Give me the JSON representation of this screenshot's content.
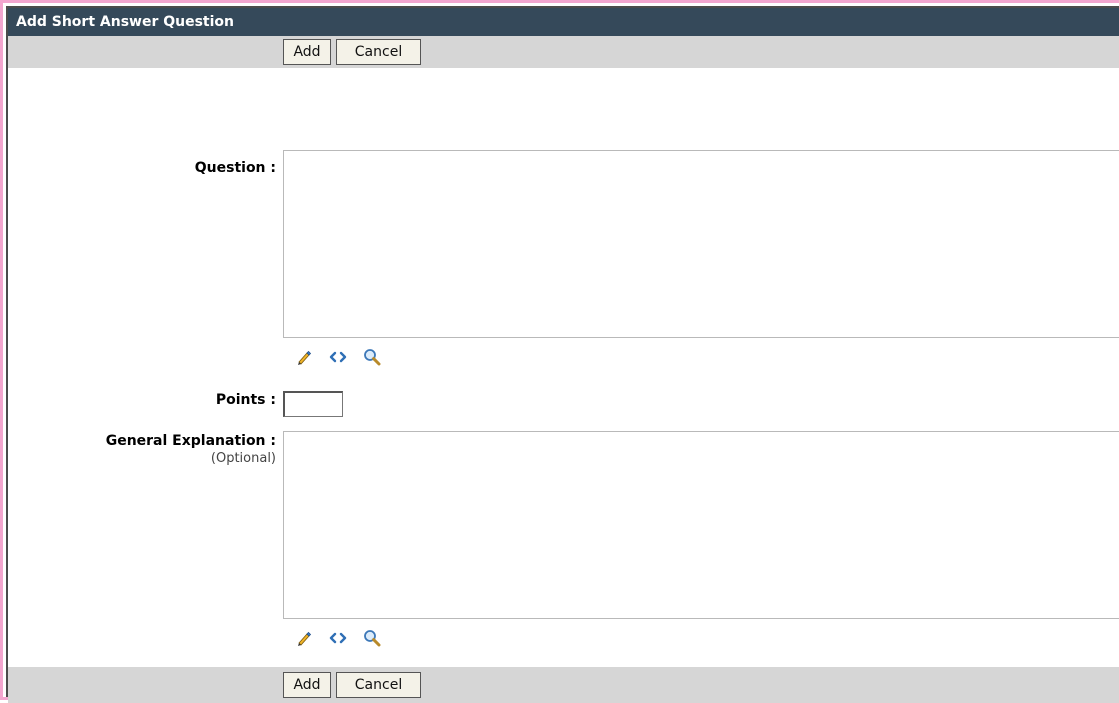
{
  "title": "Add Short Answer Question",
  "toolbar_top": {
    "add_label": "Add",
    "cancel_label": "Cancel"
  },
  "toolbar_bottom": {
    "add_label": "Add",
    "cancel_label": "Cancel"
  },
  "form": {
    "question_label": "Question :",
    "question_value": "",
    "points_label": "Points :",
    "points_value": "",
    "explanation_label": "General Explanation :",
    "explanation_optional": "(Optional)",
    "explanation_value": ""
  },
  "editor_icons": [
    "pencil-icon",
    "html-source-icon",
    "preview-magnifier-icon"
  ],
  "colors": {
    "title_bar": "#35495a",
    "toolbar": "#d6d6d6",
    "frame_border": "#f3a6cf",
    "icon_blue": "#2f6fb5"
  }
}
